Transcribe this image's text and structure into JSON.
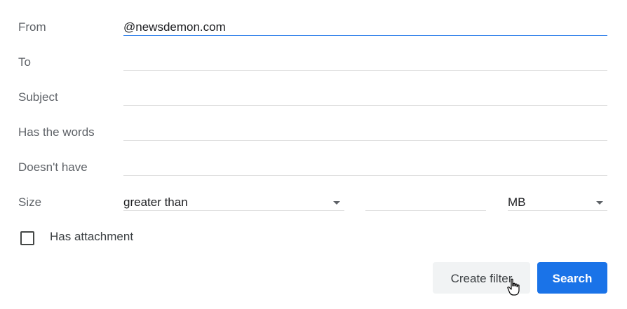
{
  "fields": {
    "from": {
      "label": "From",
      "value": "@newsdemon.com"
    },
    "to": {
      "label": "To",
      "value": ""
    },
    "subject": {
      "label": "Subject",
      "value": ""
    },
    "has_words": {
      "label": "Has the words",
      "value": ""
    },
    "doesnt_have": {
      "label": "Doesn't have",
      "value": ""
    }
  },
  "size": {
    "label": "Size",
    "operator": "greater than",
    "value": "",
    "unit": "MB"
  },
  "attachment": {
    "label": "Has attachment",
    "checked": false
  },
  "buttons": {
    "create_filter": "Create filter",
    "search": "Search"
  },
  "colors": {
    "accent": "#1a73e8",
    "label": "#5f6368",
    "underline": "#e0e0e0",
    "secondary_button": "#f1f3f4"
  },
  "icons": {
    "dropdown": "caret-down-icon",
    "pointer": "hand-pointer-icon"
  }
}
